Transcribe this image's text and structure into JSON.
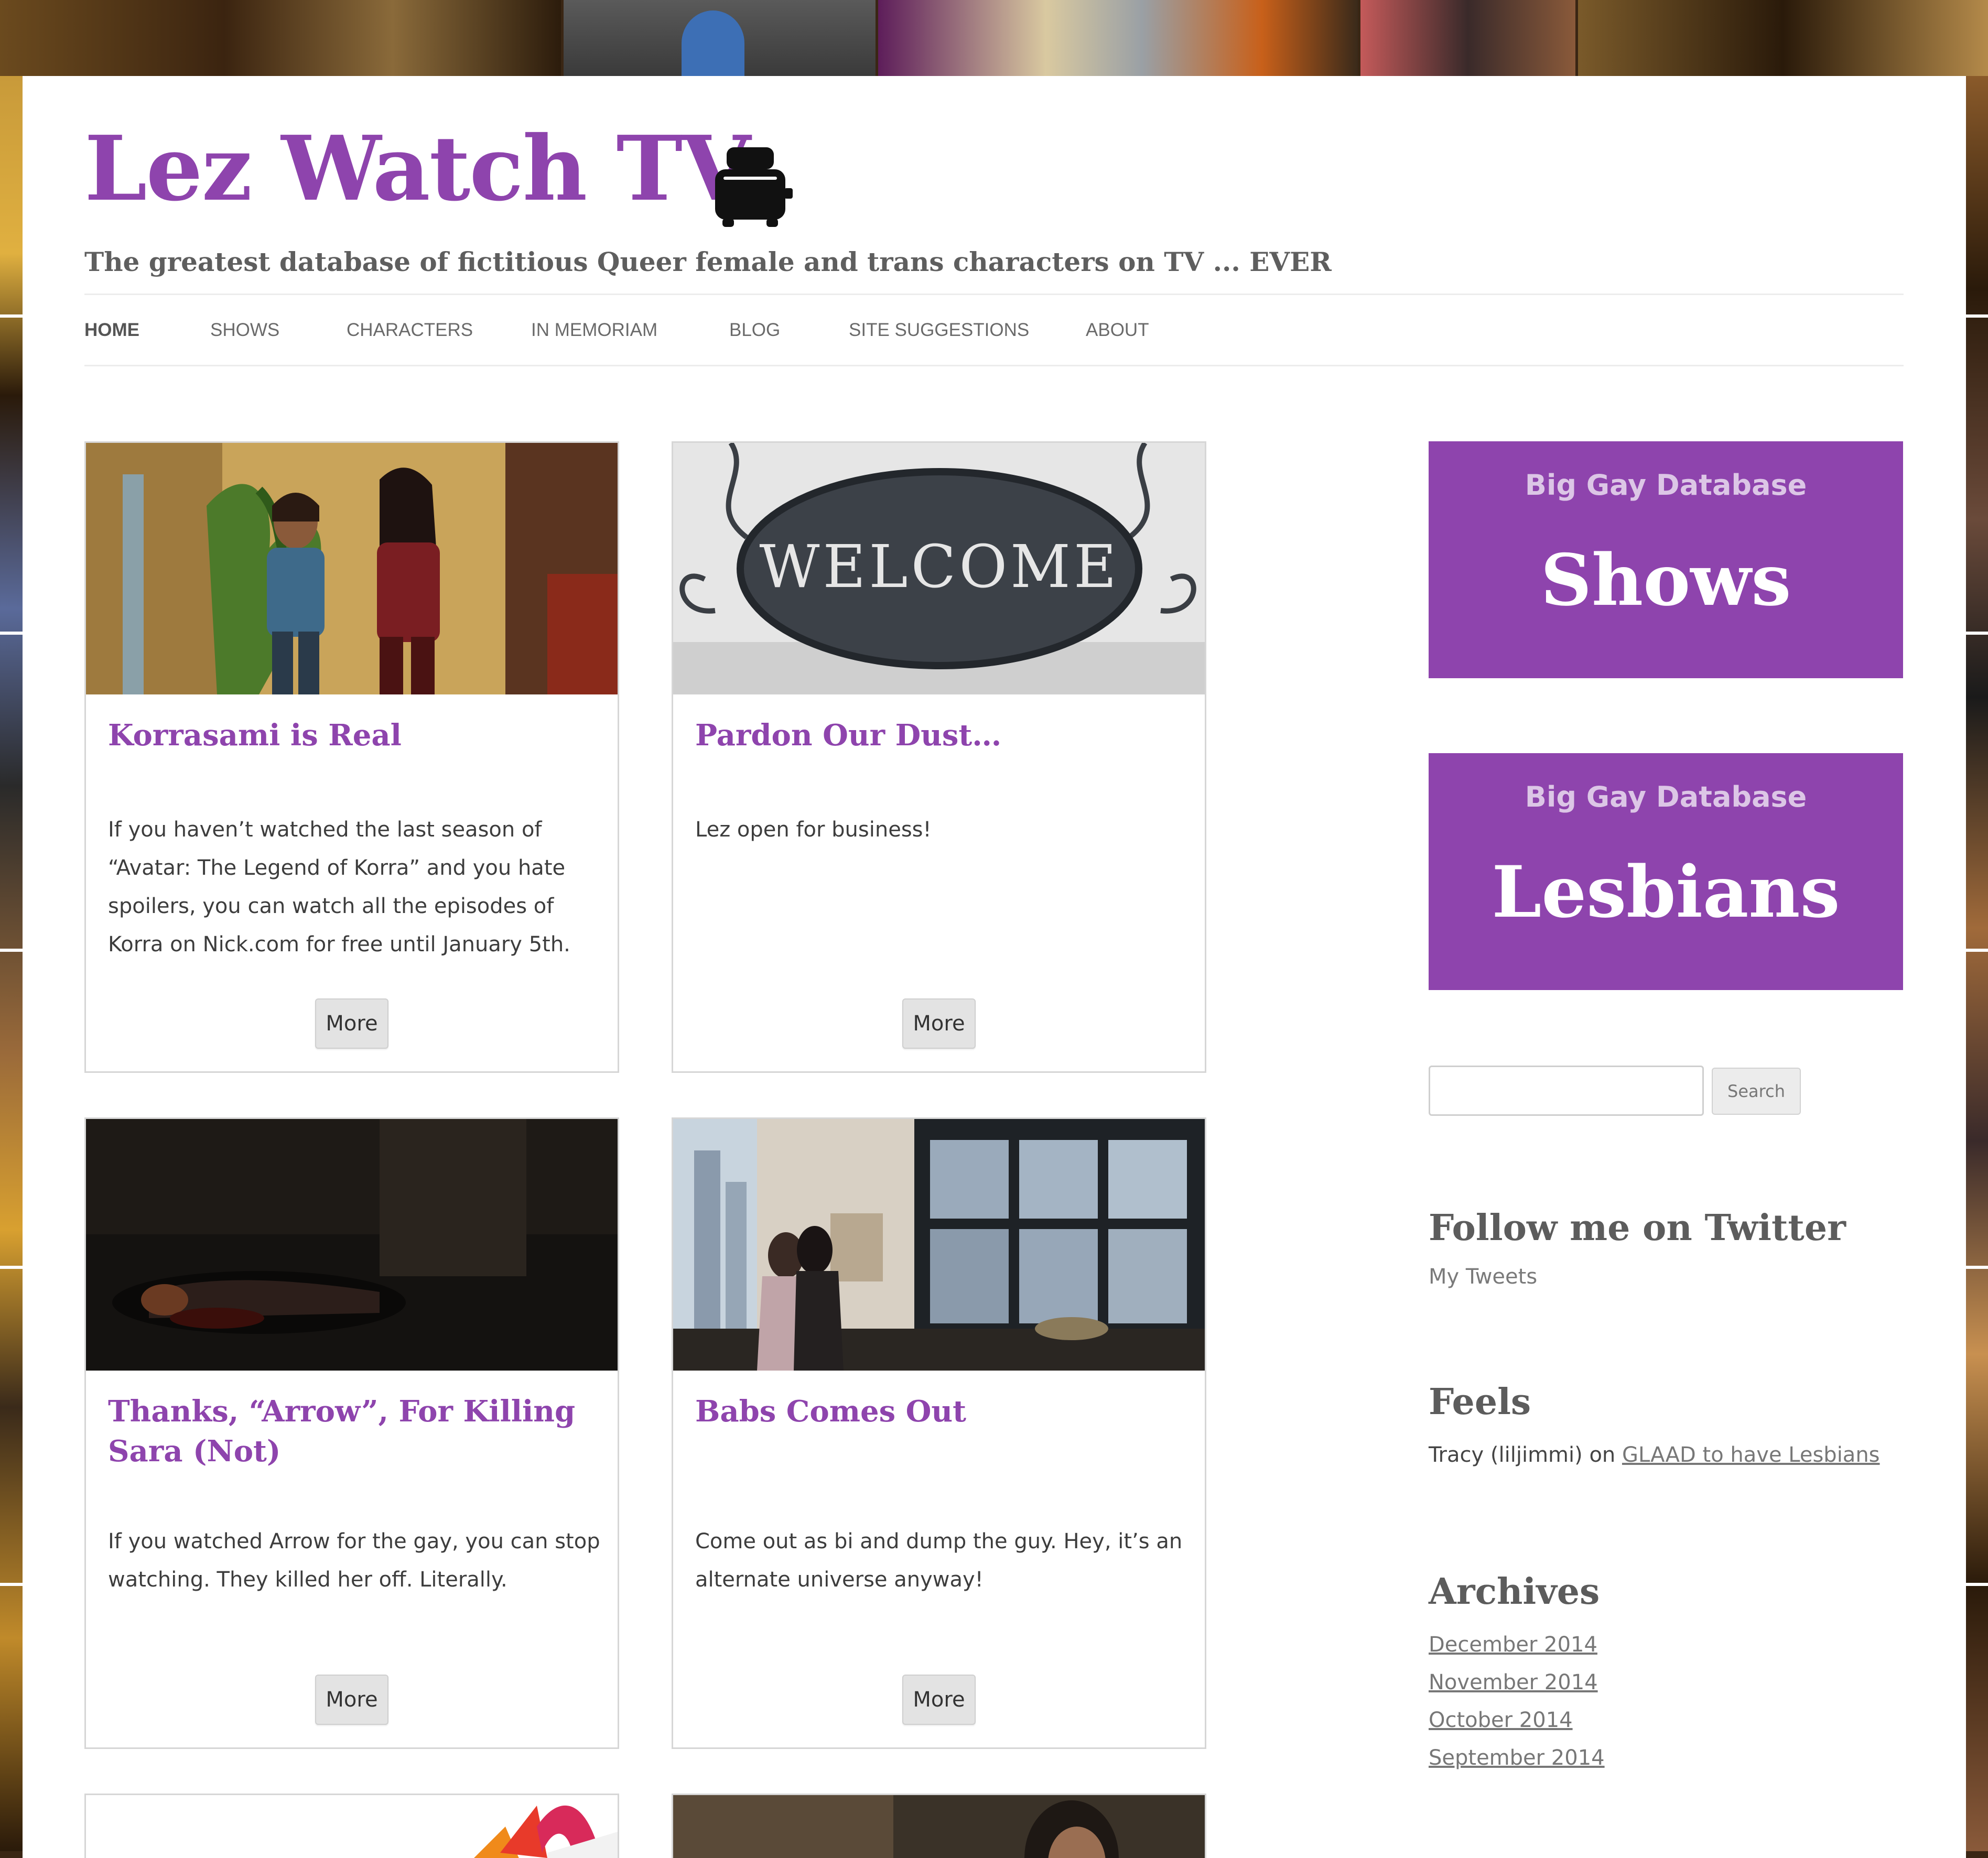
{
  "site": {
    "title": "Lez Watch TV",
    "description": "The greatest database of fictitious Queer female and trans characters on TV ... EVER",
    "logo_icon": "toaster-icon"
  },
  "nav": {
    "items": [
      {
        "label": "HOME",
        "active": true
      },
      {
        "label": "SHOWS"
      },
      {
        "label": "CHARACTERS"
      },
      {
        "label": "IN MEMORIAM"
      },
      {
        "label": "BLOG"
      },
      {
        "label": "SITE SUGGESTIONS"
      },
      {
        "label": "ABOUT"
      }
    ]
  },
  "posts": [
    {
      "title": "Korrasami is Real",
      "excerpt": "If you haven’t watched the last season of “Avatar: The Legend of Korra” and you hate spoilers, you can watch all the episodes of Korra on Nick.com for free until January 5th.",
      "more_label": "More"
    },
    {
      "title": "Pardon Our Dust…",
      "excerpt": "Lez open for business!",
      "more_label": "More",
      "image_text": "WELCOME"
    },
    {
      "title": "Thanks, “Arrow”, For Killing Sara (Not)",
      "excerpt": "If you watched Arrow for the gay, you can stop watching. They killed her off. Literally.",
      "more_label": "More"
    },
    {
      "title": "Babs Comes Out",
      "excerpt": "Come out as bi and dump the guy. Hey, it’s an alternate universe anyway!",
      "more_label": "More"
    }
  ],
  "sidebar": {
    "promos": [
      {
        "kicker": "Big Gay Database",
        "label": "Shows"
      },
      {
        "kicker": "Big Gay Database",
        "label": "Lesbians"
      }
    ],
    "search": {
      "placeholder": "",
      "button_label": "Search"
    },
    "twitter": {
      "title": "Follow me on Twitter",
      "link": "My Tweets"
    },
    "feels": {
      "title": "Feels",
      "author": "Tracy (liljimmi)",
      "connector": "on",
      "link": "GLAAD to have Lesbians"
    },
    "archives": {
      "title": "Archives",
      "months": [
        "December 2014",
        "November 2014",
        "October 2014",
        "September 2014"
      ]
    }
  },
  "colors": {
    "accent": "#8e44ad",
    "heading_gray": "#5c5c5c"
  }
}
